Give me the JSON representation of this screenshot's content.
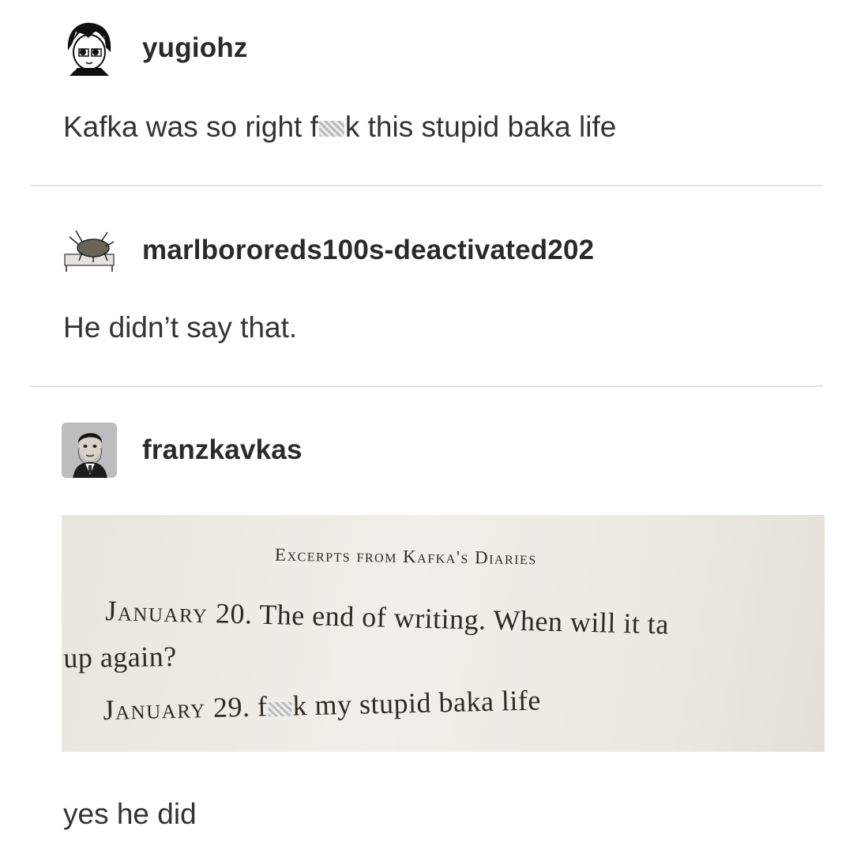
{
  "posts": [
    {
      "username": "yugiohz",
      "avatar_icon": "anime-character-avatar-icon",
      "text_before": "Kafka was so right f",
      "text_after": "k this stupid baka life"
    },
    {
      "username": "marlbororeds100s-deactivated202",
      "avatar_icon": "beetle-in-bed-avatar-icon",
      "text": "He didn’t say that."
    },
    {
      "username": "franzkavkas",
      "avatar_icon": "kafka-portrait-avatar-icon",
      "text": "yes he did"
    }
  ],
  "book_image": {
    "heading": "Excerpts from Kafka's Diaries",
    "line1_date": "January",
    "line1_rest": " 20. The end of writing. When will it ta",
    "line2": "up again?",
    "line3_date": "January",
    "line3_mid": " 29. f",
    "line3_rest": "k my  stupid baka life"
  },
  "colors": {
    "text": "#333333",
    "divider": "#e3e3e3",
    "page_bg": "#f1efe9"
  }
}
